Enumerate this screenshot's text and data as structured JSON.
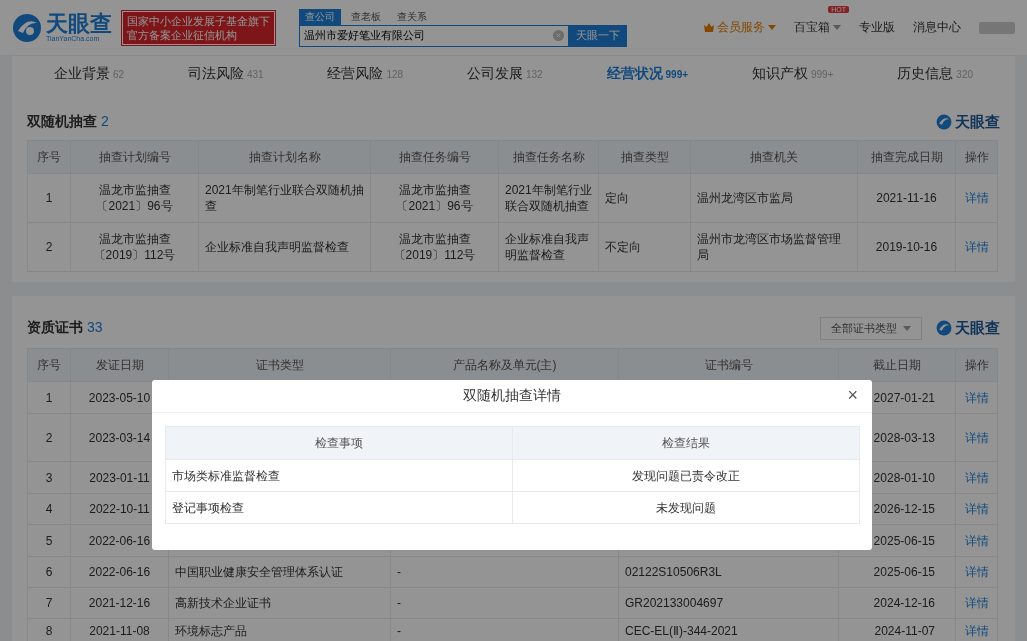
{
  "header": {
    "logo": {
      "name": "天眼查",
      "domain": "TianYanCha.com"
    },
    "badge": [
      "国家中小企业发展子基金旗下",
      "官方备案企业征信机构"
    ],
    "search_tabs": [
      {
        "label": "查公司",
        "selected": true
      },
      {
        "label": "查老板",
        "selected": false
      },
      {
        "label": "查关系",
        "selected": false
      }
    ],
    "search": {
      "value": "温州市爱好笔业有限公司"
    },
    "search_button": "天眼一下",
    "nav": [
      {
        "label": "会员服务",
        "kind": "vip"
      },
      {
        "label": "百宝箱",
        "kind": "hot",
        "badge": "HOT"
      },
      {
        "label": "专业版",
        "kind": "plain"
      },
      {
        "label": "消息中心",
        "kind": "plain"
      }
    ]
  },
  "tabs": [
    {
      "label": "企业背景",
      "count": "62",
      "selected": false
    },
    {
      "label": "司法风险",
      "count": "431",
      "selected": false
    },
    {
      "label": "经营风险",
      "count": "128",
      "selected": false
    },
    {
      "label": "公司发展",
      "count": "132",
      "selected": false
    },
    {
      "label": "经营状况",
      "count": "999+",
      "selected": true
    },
    {
      "label": "知识产权",
      "count": "999+",
      "selected": false
    },
    {
      "label": "历史信息",
      "count": "320",
      "selected": false
    }
  ],
  "audit": {
    "title": "双随机抽查",
    "count": "2",
    "brand": "天眼查",
    "columns": [
      "序号",
      "抽查计划编号",
      "抽查计划名称",
      "抽查任务编号",
      "抽查任务名称",
      "抽查类型",
      "抽查机关",
      "抽查完成日期",
      "操作"
    ],
    "rows": [
      [
        "1",
        "温龙市监抽查〔2021〕96号",
        "2021年制笔行业联合双随机抽查",
        "温龙市监抽查〔2021〕96号",
        "2021年制笔行业联合双随机抽查",
        "定向",
        "温州龙湾区市监局",
        "2021-11-16",
        "详情"
      ],
      [
        "2",
        "温龙市监抽查〔2019〕112号",
        "企业标准自我声明监督检查",
        "温龙市监抽查〔2019〕112号",
        "企业标准自我声明监督检查",
        "不定向",
        "温州市龙湾区市场监督管理局",
        "2019-10-16",
        "详情"
      ]
    ]
  },
  "certificates": {
    "title": "资质证书",
    "count": "33",
    "filter": "全部证书类型",
    "brand": "天眼查",
    "columns": [
      "序号",
      "发证日期",
      "证书类型",
      "产品名称及单元(主)",
      "证书编号",
      "截止日期",
      "操作"
    ],
    "rows": [
      {
        "no": "1",
        "issued": "2023-05-10",
        "expires": "2027-01-21",
        "action": "详情"
      },
      {
        "no": "2",
        "issued": "2023-03-14",
        "expires": "2028-03-13",
        "action": "详情"
      },
      {
        "no": "3",
        "issued": "2023-01-11",
        "expires": "2028-01-10",
        "action": "详情"
      },
      {
        "no": "4",
        "issued": "2022-10-11",
        "expires": "2026-12-15",
        "action": "详情"
      },
      {
        "no": "5",
        "issued": "2022-06-16",
        "expires": "2025-06-15",
        "action": "详情"
      },
      {
        "no": "6",
        "issued": "2022-06-16",
        "type": "中国职业健康安全管理体系认证",
        "product": "-",
        "number": "02122S10506R3L",
        "expires": "2025-06-15",
        "action": "详情"
      },
      {
        "no": "7",
        "issued": "2021-12-16",
        "type": "高新技术企业证书",
        "product": "-",
        "number": "GR202133004697",
        "expires": "2024-12-16",
        "action": "详情"
      },
      {
        "no": "8",
        "issued": "2021-11-08",
        "type": "环境标志产品",
        "product": "-",
        "number": "CEC-EL(Ⅱ)-344-2021",
        "expires": "2024-11-07",
        "action": "详情"
      }
    ]
  },
  "dialog": {
    "title": "双随机抽查详情",
    "close": "×",
    "columns": [
      "检查事项",
      "检查结果"
    ],
    "rows": [
      [
        "市场类标准监督检查",
        "发现问题已责令改正"
      ],
      [
        "登记事项检查",
        "未发现问题"
      ]
    ]
  }
}
